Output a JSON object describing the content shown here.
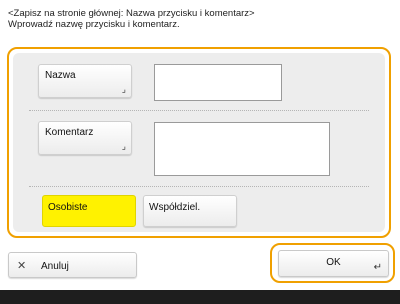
{
  "header": {
    "line1": "<Zapisz na stronie głównej: Nazwa przycisku i komentarz>",
    "line2": "Wprowadź nazwę przycisku i komentarz."
  },
  "fields": {
    "name_label": "Nazwa",
    "name_value": "",
    "comment_label": "Komentarz",
    "comment_value": ""
  },
  "sharing": {
    "personal_label": "Osobiste",
    "shared_label": "Współdziel."
  },
  "actions": {
    "cancel_label": "Anuluj",
    "ok_label": "OK"
  },
  "icons": {
    "cancel": "x-icon",
    "ok": "return-corner-icon",
    "field_corner": "corner-arrow-icon"
  },
  "colors": {
    "focus_border": "#f0a000",
    "selected": "#fff200"
  }
}
